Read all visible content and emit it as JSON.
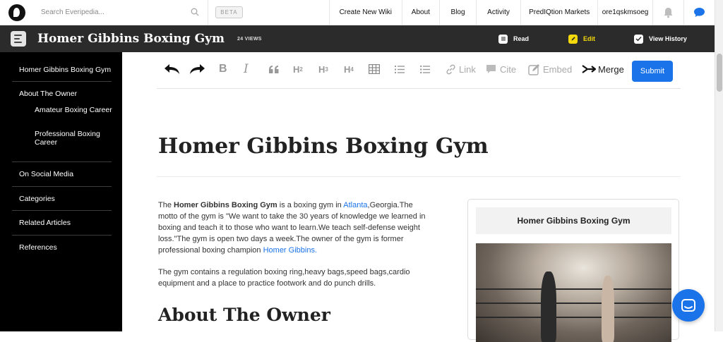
{
  "topnav": {
    "search_placeholder": "Search Everipedia...",
    "beta": "BETA",
    "links": [
      "Create New Wiki",
      "About",
      "Blog",
      "Activity",
      "PredIQtion Markets",
      "ore1qskmsoeg"
    ]
  },
  "titlebar": {
    "title": "Homer Gibbins Boxing Gym",
    "views": "24 VIEWS",
    "read": "Read",
    "edit": "Edit",
    "history": "View History"
  },
  "sidebar": {
    "items": [
      "Homer Gibbins Boxing Gym",
      "About The Owner",
      "Amateur Boxing Career",
      "Professional Boxing Career",
      "On Social Media",
      "Categories",
      "Related Articles",
      "References"
    ]
  },
  "toolbar": {
    "link": "Link",
    "cite": "Cite",
    "embed": "Embed",
    "merge": "Merge",
    "submit": "Submit"
  },
  "article": {
    "title": "Homer Gibbins Boxing Gym",
    "p1": {
      "t1": "The ",
      "bold": "Homer Gibbins Boxing Gym",
      "t2": " is a boxing gym in ",
      "link1": "Atlanta",
      "t3": ",Georgia.The motto of the gym is \"We want to take the 30 years of knowledge we learned in boxing and teach it to those who want to learn.We teach self-defense weight loss.\"The gym is open two days a week.The owner of the gym is former professional boxing champion ",
      "link2": "Homer Gibbins."
    },
    "p2": "The gym contains a regulation boxing ring,heavy bags,speed bags,cardio equipment and a place to practice footwork and do punch drills.",
    "section": "About The Owner"
  },
  "infobox": {
    "title": "Homer Gibbins Boxing Gym"
  },
  "colors": {
    "accent": "#1a73e8",
    "dark_bar": "#2b2b2b",
    "sidebar": "#000000",
    "edit_yellow": "#f5d90a"
  }
}
